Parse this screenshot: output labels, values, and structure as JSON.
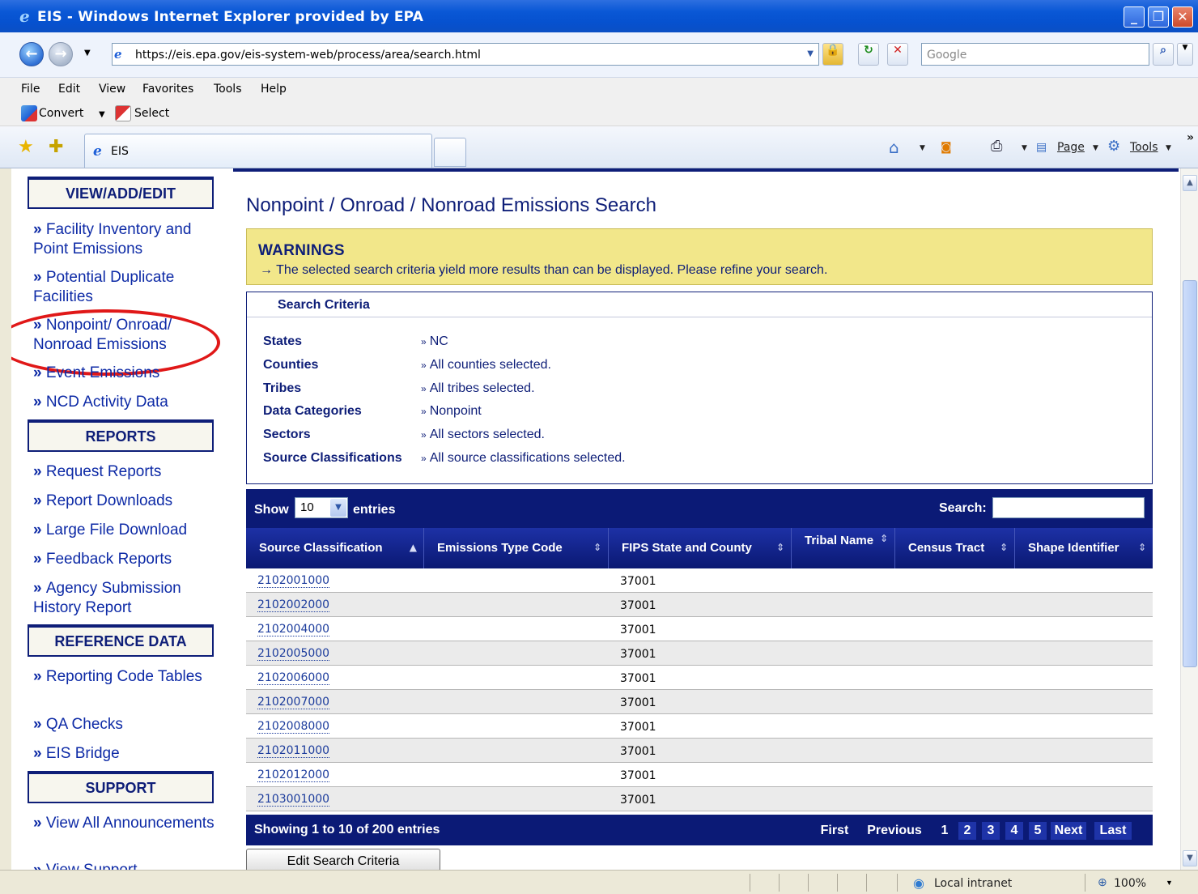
{
  "window": {
    "title": "EIS - Windows Internet Explorer provided by EPA",
    "minimize": "_",
    "maximize": "❐",
    "close": "✕"
  },
  "address": {
    "url": "https://eis.epa.gov/eis-system-web/process/area/search.html",
    "search_placeholder": "Google"
  },
  "menu": [
    "File",
    "Edit",
    "View",
    "Favorites",
    "Tools",
    "Help"
  ],
  "convert_bar": {
    "convert": "Convert",
    "select": "Select"
  },
  "tabs": {
    "active": "EIS"
  },
  "toolbar": {
    "page": "Page",
    "tools": "Tools"
  },
  "sidebar": {
    "view_add_edit": "VIEW/ADD/EDIT",
    "reports": "REPORTS",
    "reference_data": "REFERENCE DATA",
    "support": "SUPPORT",
    "links": {
      "facility": "Facility Inventory and Point Emissions",
      "duplicate": "Potential Duplicate Facilities",
      "nonpoint": "Nonpoint/ Onroad/ Nonroad Emissions",
      "event": "Event Emissions",
      "ncd": "NCD Activity Data",
      "request_reports": "Request Reports",
      "report_downloads": "Report Downloads",
      "large_file": "Large File Download",
      "feedback": "Feedback Reports",
      "agency_history": "Agency Submission History Report",
      "reporting_code": "Reporting Code Tables",
      "qa_checks": "QA Checks",
      "eis_bridge": "EIS Bridge",
      "announcements": "View All Announcements",
      "view_support": "View Support"
    }
  },
  "main": {
    "title": "Nonpoint / Onroad / Nonroad Emissions Search",
    "warnings_title": "WARNINGS",
    "warning_msg": "→ The selected search criteria yield more results than can be displayed. Please refine your search.",
    "criteria_header": "Search Criteria",
    "criteria": [
      {
        "label": "States",
        "value": "NC"
      },
      {
        "label": "Counties",
        "value": "All counties selected."
      },
      {
        "label": "Tribes",
        "value": "All tribes selected."
      },
      {
        "label": "Data Categories",
        "value": "Nonpoint"
      },
      {
        "label": "Sectors",
        "value": "All sectors selected."
      },
      {
        "label": "Source Classifications",
        "value": "All source classifications selected."
      }
    ],
    "table": {
      "show": "Show",
      "page_size": "10",
      "entries": "entries",
      "search_label": "Search:",
      "columns": [
        "Source Classification",
        "Emissions Type Code",
        "FIPS State and County",
        "Tribal Name",
        "Census Tract",
        "Shape Identifier"
      ],
      "rows": [
        {
          "source_classification": "2102001000",
          "fips": "37001"
        },
        {
          "source_classification": "2102002000",
          "fips": "37001"
        },
        {
          "source_classification": "2102004000",
          "fips": "37001"
        },
        {
          "source_classification": "2102005000",
          "fips": "37001"
        },
        {
          "source_classification": "2102006000",
          "fips": "37001"
        },
        {
          "source_classification": "2102007000",
          "fips": "37001"
        },
        {
          "source_classification": "2102008000",
          "fips": "37001"
        },
        {
          "source_classification": "2102011000",
          "fips": "37001"
        },
        {
          "source_classification": "2102012000",
          "fips": "37001"
        },
        {
          "source_classification": "2103001000",
          "fips": "37001"
        }
      ],
      "info": "Showing 1 to 10 of 200 entries",
      "pager": {
        "first": "First",
        "previous": "Previous",
        "pages": [
          "1",
          "2",
          "3",
          "4",
          "5"
        ],
        "next": "Next",
        "last": "Last"
      }
    },
    "edit_button": "Edit Search Criteria"
  },
  "status": {
    "zone": "Local intranet",
    "zoom": "100%"
  },
  "colors": {
    "navy": "#0e1e78",
    "warning_bg": "#f2e78a",
    "link": "#0d2aa6",
    "annotation": "#e01818"
  }
}
